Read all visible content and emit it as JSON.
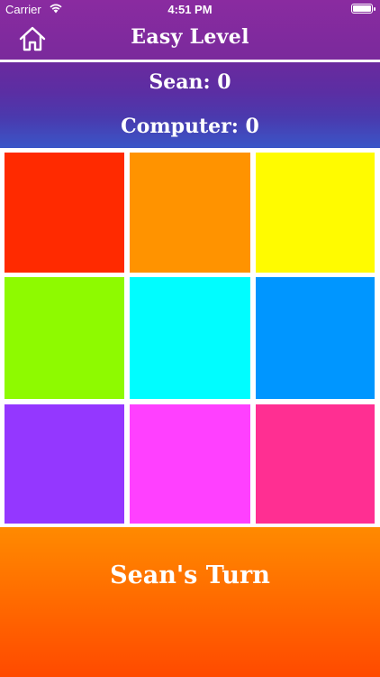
{
  "status": {
    "carrier": "Carrier",
    "time": "4:51 PM"
  },
  "header": {
    "title": "Easy Level",
    "home_icon": "home-icon"
  },
  "scores": {
    "player": "Sean: 0",
    "computer": "Computer: 0"
  },
  "board": {
    "cells": [
      {
        "color": "#ff2a00"
      },
      {
        "color": "#ff9300"
      },
      {
        "color": "#fffb00"
      },
      {
        "color": "#8efa00"
      },
      {
        "color": "#00fdff"
      },
      {
        "color": "#0096ff"
      },
      {
        "color": "#9437ff"
      },
      {
        "color": "#ff40ff"
      },
      {
        "color": "#ff2f92"
      }
    ]
  },
  "turn": {
    "label": "Sean's Turn"
  },
  "colors": {
    "header": "#8a2ba0",
    "turn_band": "#ff6a00"
  }
}
